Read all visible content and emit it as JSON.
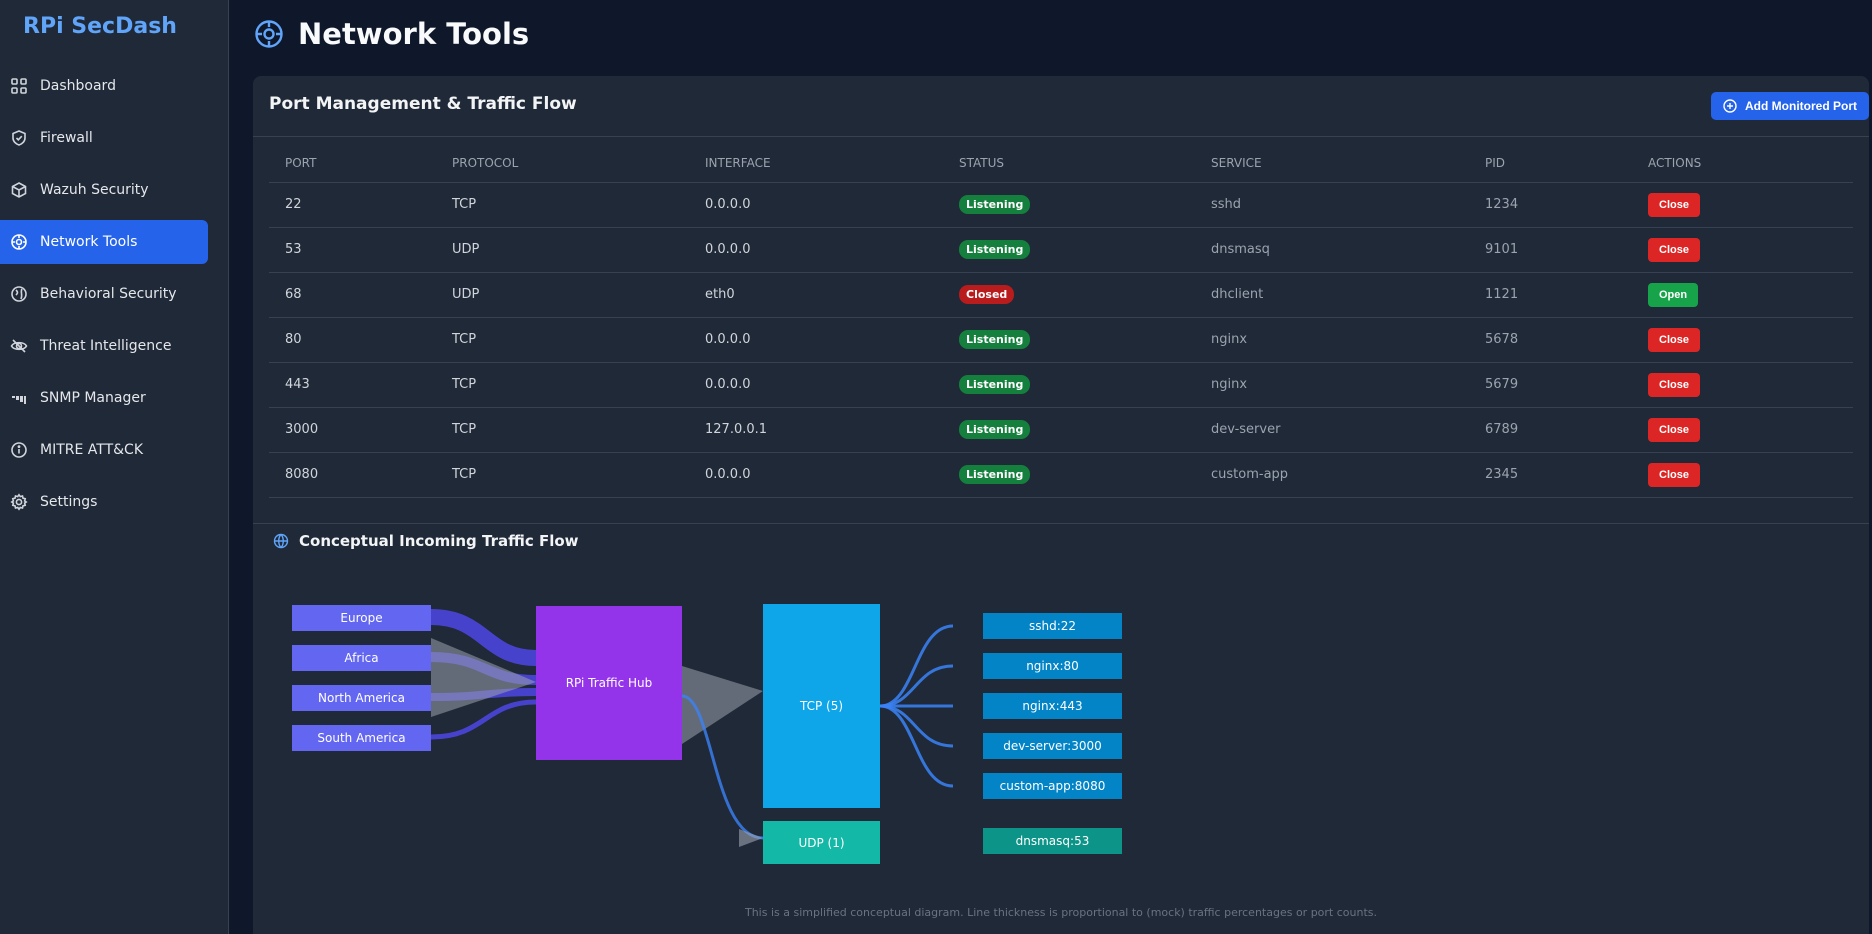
{
  "sidebar": {
    "brand": "RPi SecDash",
    "items": [
      {
        "label": "Dashboard",
        "icon": "grid-icon"
      },
      {
        "label": "Firewall",
        "icon": "shield-icon"
      },
      {
        "label": "Wazuh Security",
        "icon": "cube-icon"
      },
      {
        "label": "Network Tools",
        "icon": "crosshair-icon",
        "active": true
      },
      {
        "label": "Behavioral Security",
        "icon": "globe-icon"
      },
      {
        "label": "Threat Intelligence",
        "icon": "eye-icon"
      },
      {
        "label": "SNMP Manager",
        "icon": "signal-icon"
      },
      {
        "label": "MITRE ATT&CK",
        "icon": "info-icon"
      },
      {
        "label": "Settings",
        "icon": "gear-icon"
      }
    ]
  },
  "header": {
    "title": "Network Tools"
  },
  "card": {
    "title": "Port Management & Traffic Flow",
    "add_button": "Add Monitored Port"
  },
  "table": {
    "columns": [
      "PORT",
      "PROTOCOL",
      "INTERFACE",
      "STATUS",
      "SERVICE",
      "PID",
      "ACTIONS"
    ],
    "rows": [
      {
        "port": "22",
        "protocol": "TCP",
        "interface": "0.0.0.0",
        "status": "Listening",
        "service": "sshd",
        "pid": "1234",
        "action": "Close"
      },
      {
        "port": "53",
        "protocol": "UDP",
        "interface": "0.0.0.0",
        "status": "Listening",
        "service": "dnsmasq",
        "pid": "9101",
        "action": "Close"
      },
      {
        "port": "68",
        "protocol": "UDP",
        "interface": "eth0",
        "status": "Closed",
        "service": "dhclient",
        "pid": "1121",
        "action": "Open"
      },
      {
        "port": "80",
        "protocol": "TCP",
        "interface": "0.0.0.0",
        "status": "Listening",
        "service": "nginx",
        "pid": "5678",
        "action": "Close"
      },
      {
        "port": "443",
        "protocol": "TCP",
        "interface": "0.0.0.0",
        "status": "Listening",
        "service": "nginx",
        "pid": "5679",
        "action": "Close"
      },
      {
        "port": "3000",
        "protocol": "TCP",
        "interface": "127.0.0.1",
        "status": "Listening",
        "service": "dev-server",
        "pid": "6789",
        "action": "Close"
      },
      {
        "port": "8080",
        "protocol": "TCP",
        "interface": "0.0.0.0",
        "status": "Listening",
        "service": "custom-app",
        "pid": "2345",
        "action": "Close"
      }
    ]
  },
  "flow": {
    "title": "Conceptual Incoming Traffic Flow",
    "regions": [
      "Europe",
      "Africa",
      "North America",
      "South America"
    ],
    "hub": "RPi Traffic Hub",
    "protocols": {
      "tcp": "TCP (5)",
      "udp": "UDP (1)"
    },
    "tcp_services": [
      "sshd:22",
      "nginx:80",
      "nginx:443",
      "dev-server:3000",
      "custom-app:8080"
    ],
    "udp_services": [
      "dnsmasq:53"
    ],
    "footnote": "This is a simplified conceptual diagram. Line thickness is proportional to (mock) traffic percentages or port counts."
  },
  "colors": {
    "accent": "#2563eb",
    "region": "#6366f1",
    "hub": "#9333ea",
    "tcp": "#0ea5e9",
    "udp": "#14b8a6",
    "service": "#0284c7",
    "udp_service": "#0d9488",
    "listening": "#15803d",
    "closed": "#b91c1c"
  }
}
